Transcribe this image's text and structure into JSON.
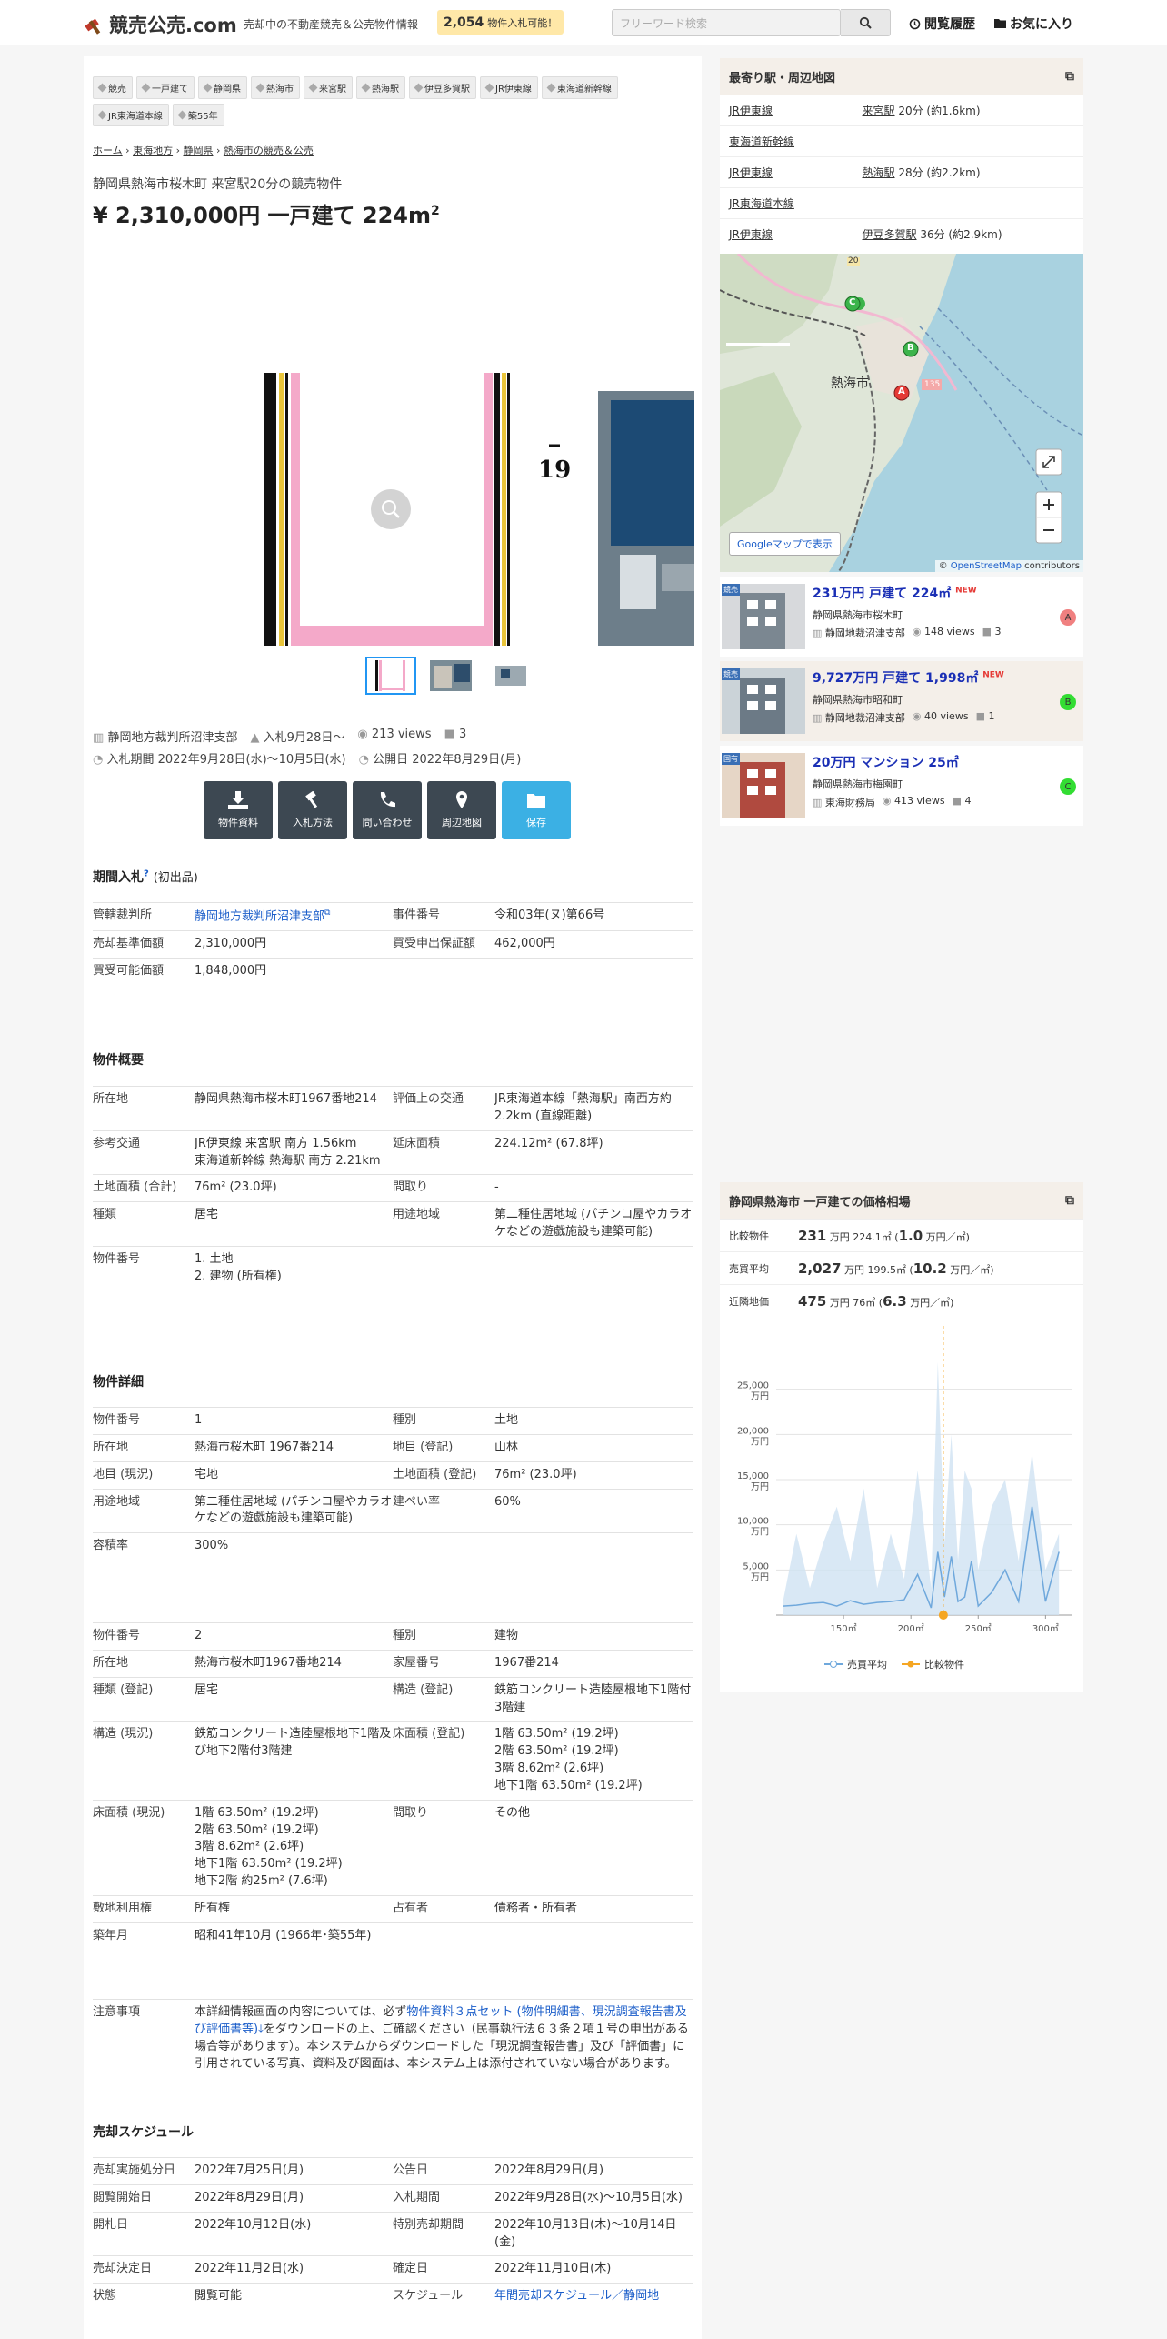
{
  "header": {
    "site_name": "競売公売.com",
    "tagline": "売却中の不動産競売＆公売物件情報",
    "count": "2,054",
    "count_label": "物件入札可能！",
    "search_placeholder": "フリーワード検索",
    "nav_history": "閲覧履歴",
    "nav_favorites": "お気に入り"
  },
  "tags": [
    "競売",
    "一戸建て",
    "静岡県",
    "熱海市",
    "来宮駅",
    "熱海駅",
    "伊豆多賀駅",
    "JR伊東線",
    "東海道新幹線",
    "JR東海道本線",
    "築55年"
  ],
  "breadcrumb": [
    "ホーム",
    "東海地方",
    "静岡県",
    "熱海市の競売＆公売"
  ],
  "property": {
    "subtitle": "静岡県熱海市桜木町 来宮駅20分の競売物件",
    "price_title": "¥ 2,310,000円 一戸建て 224m",
    "price_sup": "2"
  },
  "photo": {
    "number_mark": "19"
  },
  "meta": {
    "court": "静岡地方裁判所沼津支部",
    "bid_start": "入札9月28日〜",
    "views": "213 views",
    "comments": "3",
    "bid_period": "入札期間 2022年9月28日(水)〜10月5日(水)",
    "publish": "公開日 2022年8月29日(月)"
  },
  "buttons": [
    "物件資料",
    "入札方法",
    "問い合わせ",
    "周辺地図",
    "保存"
  ],
  "auction": {
    "heading": "期間入札",
    "heading_sup": "?",
    "heading_note": "(初出品)",
    "rows": [
      {
        "k1": "管轄裁判所",
        "v1": "静岡地方裁判所沼津支部",
        "k2": "事件番号",
        "v2": "令和03年(ヌ)第66号"
      },
      {
        "k1": "売却基準価額",
        "v1": "2,310,000円",
        "k2": "買受申出保証額",
        "v2": "462,000円"
      },
      {
        "k1": "買受可能価額",
        "v1": "1,848,000円",
        "k2": "",
        "v2": ""
      }
    ]
  },
  "overview": {
    "heading": "物件概要",
    "rows": [
      {
        "k1": "所在地",
        "v1": "静岡県熱海市桜木町1967番地214",
        "k2": "評価上の交通",
        "v2": "JR東海道本線「熱海駅」南西方約2.2km (直線距離)"
      },
      {
        "k1": "参考交通",
        "v1": "JR伊東線 来宮駅 南方 1.56km\n東海道新幹線 熱海駅 南方 2.21km",
        "k2": "延床面積",
        "v2": "224.12m² (67.8坪)"
      },
      {
        "k1": "土地面積 (合計)",
        "v1": "76m² (23.0坪)",
        "k2": "間取り",
        "v2": "-"
      },
      {
        "k1": "種類",
        "v1": "居宅",
        "k2": "用途地域",
        "v2": "第二種住居地域 (パチンコ屋やカラオケなどの遊戯施設も建築可能)"
      },
      {
        "k1": "物件番号",
        "v1": "1. 土地\n2. 建物 (所有権)",
        "k2": "",
        "v2": ""
      }
    ]
  },
  "detail": {
    "heading": "物件詳細",
    "rows1": [
      {
        "k1": "物件番号",
        "v1": "1",
        "k2": "種別",
        "v2": "土地"
      },
      {
        "k1": "所在地",
        "v1": "熱海市桜木町 1967番214",
        "k2": "地目 (登記)",
        "v2": "山林"
      },
      {
        "k1": "地目 (現況)",
        "v1": "宅地",
        "k2": "土地面積 (登記)",
        "v2": "76m² (23.0坪)"
      },
      {
        "k1": "用途地域",
        "v1": "第二種住居地域 (パチンコ屋やカラオケなどの遊戯施設も建築可能)",
        "k2": "建ぺい率",
        "v2": "60%"
      },
      {
        "k1": "容積率",
        "v1": "300%",
        "k2": "",
        "v2": ""
      }
    ],
    "rows2": [
      {
        "k1": "物件番号",
        "v1": "2",
        "k2": "種別",
        "v2": "建物"
      },
      {
        "k1": "所在地",
        "v1": "熱海市桜木町1967番地214",
        "k2": "家屋番号",
        "v2": "1967番214"
      },
      {
        "k1": "種類 (登記)",
        "v1": "居宅",
        "k2": "構造 (登記)",
        "v2": "鉄筋コンクリート造陸屋根地下1階付3階建"
      },
      {
        "k1": "構造 (現況)",
        "v1": "鉄筋コンクリート造陸屋根地下1階及び地下2階付3階建",
        "k2": "床面積 (登記)",
        "v2": "1階 63.50m² (19.2坪)\n2階 63.50m² (19.2坪)\n3階 8.62m² (2.6坪)\n地下1階 63.50m² (19.2坪)"
      },
      {
        "k1": "床面積 (現況)",
        "v1": "1階 63.50m² (19.2坪)\n2階 63.50m² (19.2坪)\n3階 8.62m² (2.6坪)\n地下1階 63.50m² (19.2坪)\n地下2階 約25m² (7.6坪)",
        "k2": "間取り",
        "v2": "その他"
      },
      {
        "k1": "敷地利用権",
        "v1": "所有権",
        "k2": "占有者",
        "v2": "債務者・所有者"
      },
      {
        "k1": "築年月",
        "v1": "昭和41年10月 (1966年･築55年)",
        "k2": "",
        "v2": ""
      }
    ]
  },
  "notice": {
    "label": "注意事項",
    "text_a": "本詳細情報画面の内容については、必ず",
    "link": "物件資料３点セット (物件明細書、現況調査報告書及び評価書等)",
    "text_b": "をダウンロードの上、ご確認ください（民事執行法６３条２項１号の申出がある場合等があります）。本システムからダウンロードした「現況調査報告書」及び「評価書」に引用されている写真、資料及び図面は、本システム上は添付されていない場合があります。"
  },
  "schedule": {
    "heading": "売却スケジュール",
    "rows": [
      {
        "k1": "売却実施処分日",
        "v1": "2022年7月25日(月)",
        "k2": "公告日",
        "v2": "2022年8月29日(月)"
      },
      {
        "k1": "閲覧開始日",
        "v1": "2022年8月29日(月)",
        "k2": "入札期間",
        "v2": "2022年9月28日(水)〜10月5日(水)"
      },
      {
        "k1": "開札日",
        "v1": "2022年10月12日(水)",
        "k2": "特別売却期間",
        "v2": "2022年10月13日(木)〜10月14日(金)"
      },
      {
        "k1": "売却決定日",
        "v1": "2022年11月2日(水)",
        "k2": "確定日",
        "v2": "2022年11月10日(木)"
      },
      {
        "k1": "状態",
        "v1": "閲覧可能",
        "k2": "スケジュール",
        "v2": "年間売却スケジュール／静岡地"
      }
    ]
  },
  "stations": {
    "heading": "最寄り駅・周辺地図",
    "rows": [
      {
        "line": "JR伊東線",
        "station": "来宮駅",
        "dist": "20分 (約1.6km)"
      },
      {
        "line": "東海道新幹線",
        "station": "",
        "dist": ""
      },
      {
        "line": "JR伊東線",
        "station": "熱海駅",
        "dist": "28分 (約2.2km)"
      },
      {
        "line": "JR東海道本線",
        "station": "",
        "dist": ""
      },
      {
        "line": "JR伊東線",
        "station": "伊豆多賀駅",
        "dist": "36分 (約2.9km)"
      }
    ]
  },
  "map": {
    "city_label": "熱海市",
    "road_20": "20",
    "road_135": "135",
    "gmaps_btn": "Googleマップで表示",
    "attribution_a": "© ",
    "attribution_link": "OpenStreetMap",
    "attribution_b": " contributors",
    "markers": [
      "A",
      "B",
      "C"
    ]
  },
  "cards": [
    {
      "badge": "競売",
      "title": "231万円 戸建て 224㎡",
      "new": "NEW",
      "addr": "静岡県熱海市桜木町",
      "court": "静岡地裁沼津支部",
      "views": "148 views",
      "comments": "3",
      "marker": "A",
      "bg": "#ffffff"
    },
    {
      "badge": "競売",
      "title": "9,727万円 戸建て 1,998㎡",
      "new": "NEW",
      "addr": "静岡県熱海市昭和町",
      "court": "静岡地裁沼津支部",
      "views": "40 views",
      "comments": "1",
      "marker": "B",
      "bg": "#f4efe9"
    },
    {
      "badge": "国有",
      "title": "20万円 マンション 25㎡",
      "new": "",
      "addr": "静岡県熱海市梅園町",
      "court": "東海財務局",
      "views": "413 views",
      "comments": "4",
      "marker": "C",
      "bg": "#ffffff"
    }
  ],
  "price_box": {
    "heading": "静岡県熱海市 一戸建ての価格相場",
    "rows": [
      {
        "k": "比較物件",
        "big": "231",
        "unit": "万円 224.1㎡ (",
        "big2": "1.0",
        "unit2": "万円／㎡)"
      },
      {
        "k": "売買平均",
        "big": "2,027",
        "unit": "万円 199.5㎡ (",
        "big2": "10.2",
        "unit2": "万円／㎡)"
      },
      {
        "k": "近隣地価",
        "big": "475",
        "unit": "万円 76㎡ (",
        "big2": "6.3",
        "unit2": "万円／㎡)"
      }
    ]
  },
  "chart_data": {
    "type": "area",
    "title": "",
    "xlabel": "",
    "ylabel": "",
    "x": [
      105,
      115,
      125,
      135,
      145,
      155,
      165,
      175,
      185,
      195,
      205,
      215,
      220,
      225,
      230,
      235,
      240,
      245,
      250,
      260,
      270,
      280,
      290,
      300,
      310
    ],
    "series": [
      {
        "name": "売買平均",
        "values": [
          1000,
          1100,
          1300,
          1400,
          1000,
          1600,
          1200,
          1400,
          1500,
          1700,
          4500,
          800,
          7000,
          2000,
          6500,
          1500,
          2000,
          6000,
          1000,
          2500,
          5000,
          1500,
          12000,
          1500,
          7000
        ],
        "upper": [
          1500,
          9000,
          3000,
          8000,
          12000,
          6000,
          14000,
          3000,
          9000,
          4000,
          16000,
          3000,
          28000,
          8000,
          20000,
          6000,
          16000,
          14000,
          5000,
          12000,
          15000,
          6000,
          18000,
          5000,
          9000
        ]
      },
      {
        "name": "比較物件",
        "x": 224.1,
        "value": 0
      }
    ],
    "yticks": [
      "25,000",
      "20,000",
      "15,000",
      "10,000",
      "5,000"
    ],
    "ytick_unit": "万円",
    "xticks": [
      "150㎡",
      "200㎡",
      "250㎡",
      "300㎡"
    ],
    "xtick_values": [
      150,
      200,
      250,
      300
    ],
    "ylim": [
      0,
      30000
    ],
    "xlim": [
      100,
      320
    ],
    "colors": {
      "avg": "#6fa8dc",
      "band": "#cfe2f3",
      "cmp": "#f5a623"
    },
    "legend_position": "bottom"
  }
}
